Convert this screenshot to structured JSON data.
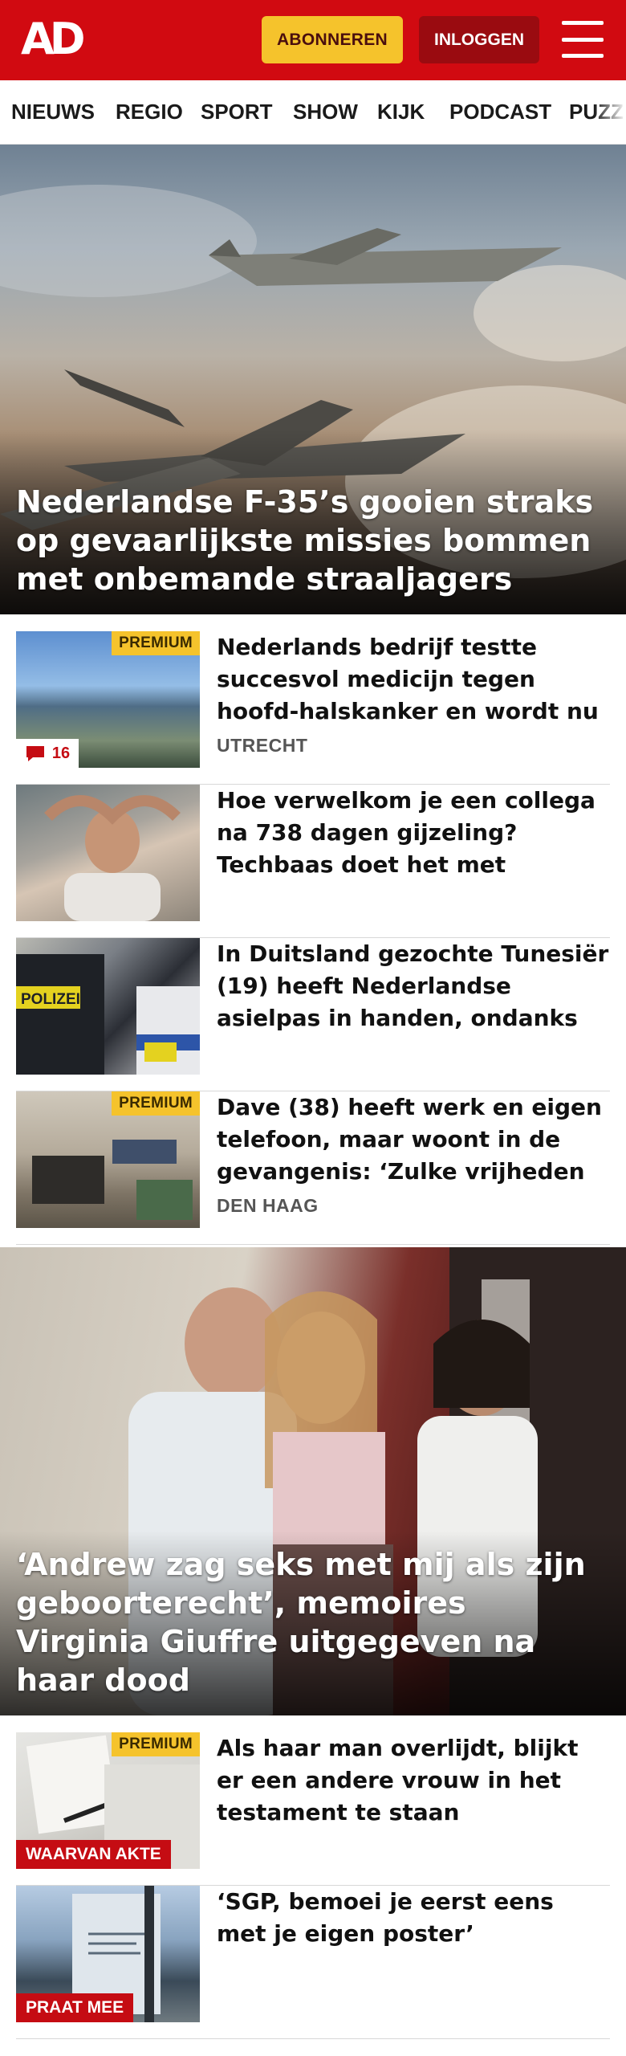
{
  "header": {
    "logo_text": "AD",
    "subscribe_label": "ABONNEREN",
    "login_label": "INLOGGEN",
    "brand_color": "#d10a11",
    "subscribe_color": "#f5c32c"
  },
  "nav": {
    "items": [
      "NIEUWS",
      "REGIO",
      "SPORT",
      "SHOW",
      "KIJK",
      "PODCAST",
      "PUZZ"
    ]
  },
  "hero1": {
    "title": "Nederlandse F-35’s gooien straks op gevaarlijkste missies bommen met onbemande straaljagers"
  },
  "articles": [
    {
      "headline": "Nederlands bedrijf testte succesvol medicijn tegen hoofd-halskanker en wordt nu voor…",
      "location": "UTRECHT",
      "badge": "PREMIUM",
      "comments": "16"
    },
    {
      "headline": "Hoe verwelkom je een collega na 738 dagen gijzeling? Techbaas doet het met plaagstoot die…"
    },
    {
      "headline": "In Duitsland gezochte Tunesiër (19) heeft Nederlandse asielpas in handen, ondanks arrestatieb…",
      "photo_text": "POLIZEI"
    },
    {
      "headline": "Dave (38) heeft werk en eigen telefoon, maar woont in de gevangenis: ‘Zulke vrijheden zij…",
      "location": "DEN HAAG",
      "badge": "PREMIUM"
    }
  ],
  "hero2": {
    "title": "‘Andrew zag seks met mij als zijn geboorterecht’, memoires Virginia Giuffre uitgegeven na haar dood"
  },
  "articles2": [
    {
      "headline": "Als haar man overlijdt, blijkt er een andere vrouw in het testament te staan",
      "badge": "PREMIUM",
      "label": "WAARVAN AKTE"
    },
    {
      "headline": "‘SGP, bemoei je eerst eens met je eigen poster’",
      "label": "PRAAT MEE"
    }
  ]
}
